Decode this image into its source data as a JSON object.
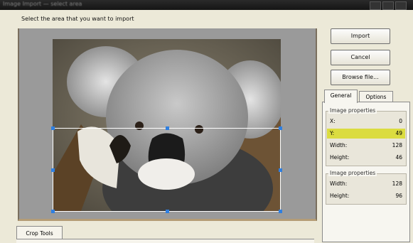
{
  "window": {
    "title": "Image Import — select area"
  },
  "instruction": "Select the area that you want to import",
  "buttons": {
    "import": "Import",
    "cancel": "Cancel",
    "browse": "Browse file..."
  },
  "tabs": [
    {
      "label": "General",
      "active": true
    },
    {
      "label": "Options",
      "active": false
    }
  ],
  "crop_group": {
    "title": "Image properties",
    "rows": [
      {
        "label": "X:",
        "value": "0",
        "highlighted": false
      },
      {
        "label": "Y:",
        "value": "49",
        "highlighted": true
      },
      {
        "label": "Width:",
        "value": "128",
        "highlighted": false
      },
      {
        "label": "Height:",
        "value": "46",
        "highlighted": false
      }
    ]
  },
  "image_group": {
    "title": "Image properties",
    "rows": [
      {
        "label": "Width:",
        "value": "128"
      },
      {
        "label": "Height:",
        "value": "96"
      }
    ]
  },
  "bottom_tab": "Crop Tools",
  "colors": {
    "highlight": "#dbdc40",
    "handle": "#2f7fe0",
    "canvas_bg": "#9a9a9a",
    "window_bg": "#ece9d8"
  },
  "icons": {
    "selection_handle": "square-handle"
  }
}
